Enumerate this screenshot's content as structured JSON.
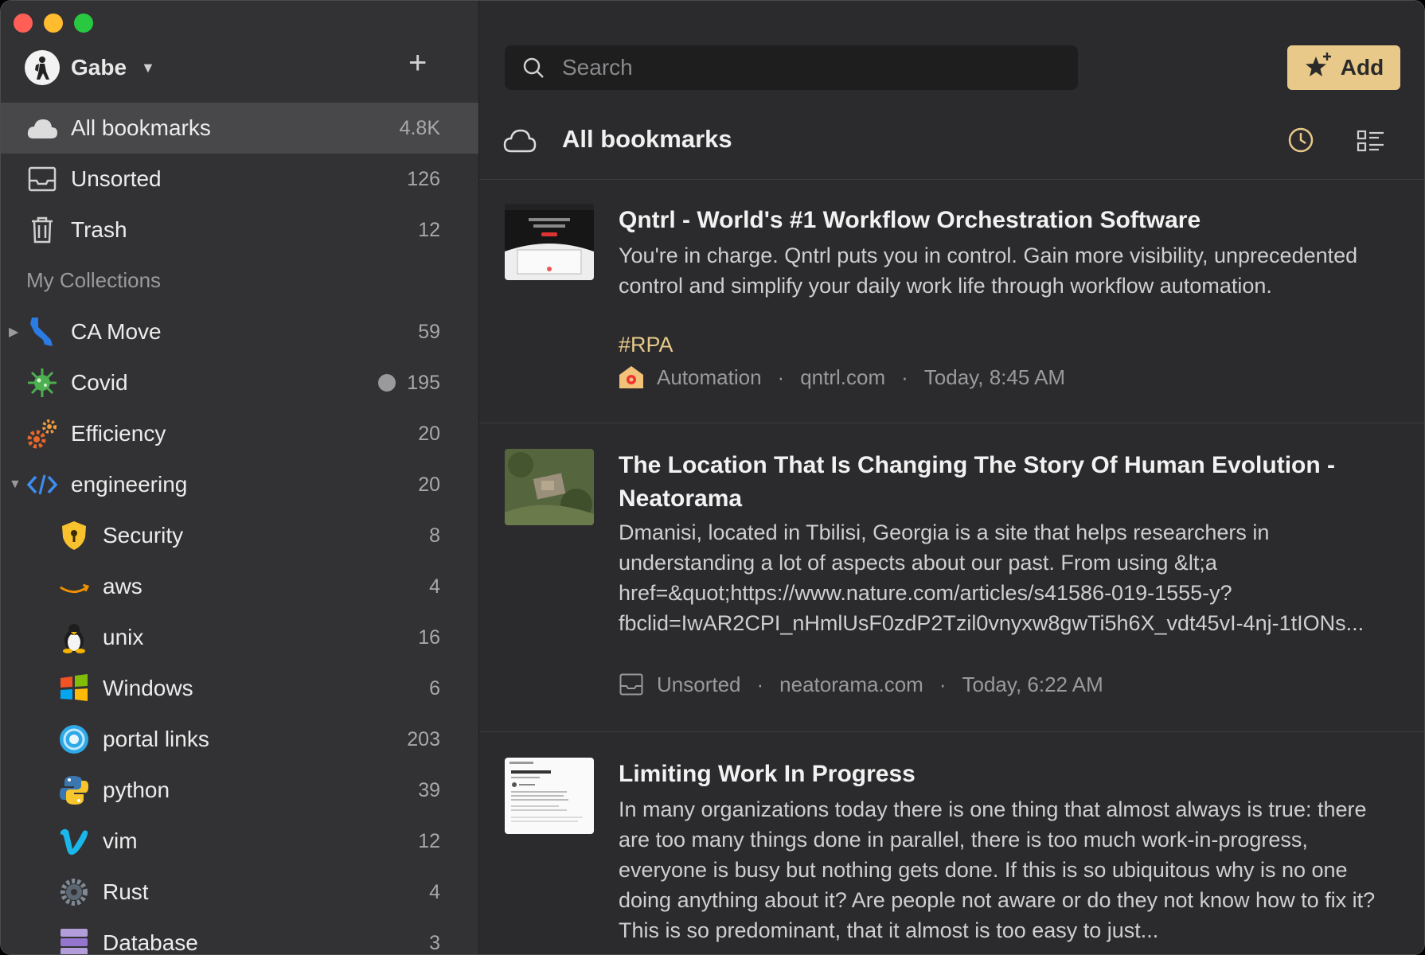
{
  "user": {
    "name": "Gabe"
  },
  "sidebar": {
    "top_items": [
      {
        "label": "All bookmarks",
        "count": "4.8K",
        "icon": "cloud-icon"
      },
      {
        "label": "Unsorted",
        "count": "126",
        "icon": "inbox-icon"
      },
      {
        "label": "Trash",
        "count": "12",
        "icon": "trash-icon"
      }
    ],
    "section_title": "My Collections",
    "collections": [
      {
        "label": "CA Move",
        "count": "59",
        "icon": "california-icon"
      },
      {
        "label": "Covid",
        "count": "195",
        "icon": "virus-icon"
      },
      {
        "label": "Efficiency",
        "count": "20",
        "icon": "gears-icon"
      },
      {
        "label": "engineering",
        "count": "20",
        "icon": "code-icon"
      },
      {
        "label": "Security",
        "count": "8",
        "icon": "shield-icon"
      },
      {
        "label": "aws",
        "count": "4",
        "icon": "aws-icon"
      },
      {
        "label": "unix",
        "count": "16",
        "icon": "penguin-icon"
      },
      {
        "label": "Windows",
        "count": "6",
        "icon": "windows-icon"
      },
      {
        "label": "portal links",
        "count": "203",
        "icon": "portal-icon"
      },
      {
        "label": "python",
        "count": "39",
        "icon": "python-icon"
      },
      {
        "label": "vim",
        "count": "12",
        "icon": "vim-icon"
      },
      {
        "label": "Rust",
        "count": "4",
        "icon": "rust-gear-icon"
      },
      {
        "label": "Database",
        "count": "3",
        "icon": "database-icon"
      }
    ]
  },
  "search": {
    "placeholder": "Search"
  },
  "add_button": {
    "label": "Add"
  },
  "header": {
    "title": "All bookmarks"
  },
  "bookmarks": [
    {
      "title": "Qntrl - World's #1 Workflow Orchestration Software",
      "desc": "You're in charge. Qntrl puts you in control. Gain more visibility, unprecedented control and simplify your daily work life through workflow automation.",
      "tag": "#RPA",
      "collection": "Automation",
      "domain": "qntrl.com",
      "time": "Today, 8:45 AM"
    },
    {
      "title": "The Location That Is Changing The Story Of Human Evolution - Neatorama",
      "desc": "Dmanisi, located in Tbilisi, Georgia is a site that helps researchers in understanding a lot of aspects about our past. From using &lt;a href=&quot;https://www.nature.com/articles/s41586-019-1555-y?fbclid=IwAR2CPI_nHmlUsF0zdP2Tzil0vnyxw8gwTi5h6X_vdt45vI-4nj-1tIONs...",
      "collection": "Unsorted",
      "domain": "neatorama.com",
      "time": "Today, 6:22 AM"
    },
    {
      "title": "Limiting Work In Progress",
      "desc": "In many organizations today there is one thing that almost always is true: there are too many things done in parallel, there is too much work-in-progress, everyone is busy but nothing gets done. If this is so ubiquitous why is no one doing anything about it? Are people not aware or do they not know how to fix it? This is so predominant, that it almost is too easy to just..."
    }
  ],
  "colors": {
    "accent": "#e8c98a",
    "sidebar_bg": "#323234",
    "main_bg": "#2b2b2d"
  }
}
